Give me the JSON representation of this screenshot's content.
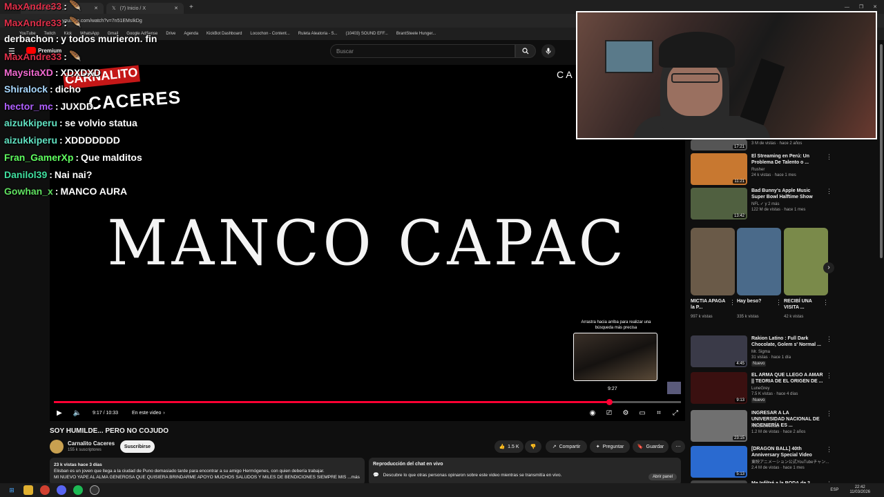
{
  "browser": {
    "tabs": [
      {
        "label": "MaxAndre33 - F..."
      },
      {
        "label": "(7) Inicio / X"
      }
    ],
    "url": "youtube.com/watch?v=7n51EMsIkDg",
    "bookmarks": [
      "YouTube",
      "Twitch",
      "Kick",
      "WhatsApp",
      "Gmail",
      "Google AdSense",
      "Drive",
      "Agenda",
      "KickBot Dashboard",
      "Locochon - Content...",
      "Ruleta Aleatoria - S...",
      "(10403) SOUND EFF...",
      "BrantSteele Hunger..."
    ]
  },
  "youtube": {
    "brand": "Premium",
    "search_placeholder": "Buscar"
  },
  "player": {
    "overlay_text": "MANCO CAPAC",
    "logo_top": "CARNALITO",
    "logo_bottom": "CACERES",
    "hint": "Arrastra hacia arriba para realizar una búsqueda más precisa",
    "preview_time": "9:27",
    "progress": 0.885,
    "time": "9:17 / 10:33",
    "chapter": "En este video",
    "corner_letters": "C A"
  },
  "video": {
    "title": "SOY HUMILDE... PERO NO COJUDO",
    "channel": "Carnalito Caceres",
    "subs": "155 k suscriptores",
    "subscribe": "Suscribirse",
    "likes": "1.5 K",
    "share": "Compartir",
    "ask": "Preguntar",
    "save": "Guardar",
    "desc_meta": "23 k vistas  hace 3 días",
    "desc_line1": "Elisban es un joven que llega a la ciudad de Puno demasiado tarde para encontrar a su amigo Hermógenes, con quien debería trabajar.",
    "desc_line2": "MI NUEVO YAPE AL ALMA GENEROSA QUE QUISIERA BRINDARME APOYO MUCHOS SALUDOS Y MILES DE BENDICIONES SIEMPRE MIS ...más",
    "chat_title": "Reproducción del chat en vivo",
    "chat_desc": "Descubre lo que otras personas opinaron sobre este video mientras se transmitía en vivo.",
    "chat_btn": "Abrir panel"
  },
  "sidebar": {
    "top_item": {
      "meta": "3 M de vistas · hace 2 años",
      "dur": "17:21"
    },
    "items": [
      {
        "title": "El Streaming en Perú: Un Problema De Talento o ...",
        "channel": "Rusher",
        "meta": "24 k vistas · hace 1 mes",
        "dur": "11:21",
        "color": "#c87830"
      },
      {
        "title": "Bad Bunny's Apple Music Super Bowl Halftime Show",
        "channel": "NFL ✓ y 2 más",
        "meta": "122 M de vistas · hace 1 mes",
        "dur": "13:42",
        "color": "#506040"
      },
      {
        "title": "Rakion Latino : Full Dark Chocolate, Golem s' Normal ...",
        "channel": "Mr. Sigma",
        "meta": "31 vistas · hace 1 día",
        "badge": "Nuevo",
        "dur": "4:45",
        "color": "#3a3a48"
      },
      {
        "title": "EL ARMA QUE LLEGO A AMAR || TEORIA DE EL ORIGEN DE ...",
        "channel": "LuneGrey",
        "meta": "7.5 K vistas · hace 4 días",
        "badge": "Nuevo",
        "dur": "9:13",
        "color": "#3a1010"
      },
      {
        "title": "INGRESAR A LA UNIVERSIDAD NACIONAL DE INGENIERÍA ES ...",
        "channel": "NN Entrevistas",
        "meta": "1.2 M de vistas · hace 2 años",
        "dur": "23:15",
        "color": "#707070"
      },
      {
        "title": "[DRAGON BALL] 40th Anniversary Special Video",
        "channel": "東映アニメーション公式YouTubeチャン...",
        "meta": "2.4 M de vistas · hace 1 mes",
        "dur": "5:13",
        "color": "#2a6ad0"
      },
      {
        "title": "Me Infiltré a la BODA de 2 ...",
        "channel": "",
        "meta": "",
        "dur": "",
        "color": "#444"
      }
    ],
    "shorts": [
      {
        "title": "MICTIA APAGA la P...",
        "views": "997 k vistas",
        "color": "#6a5a48"
      },
      {
        "title": "Hay beso?",
        "views": "335 k vistas",
        "color": "#4a6a8a"
      },
      {
        "title": "RECIBÍ UNA VISITA ...",
        "views": "42 k vistas",
        "color": "#7a8a4a"
      }
    ]
  },
  "chat": [
    {
      "user": "MaxAndre33",
      "msg": "",
      "color": "#e0304a"
    },
    {
      "user": "MaxAndre33",
      "msg": "",
      "color": "#e0304a"
    },
    {
      "user": "derbachon",
      "msg": "y todos murieron. fin",
      "color": "#ffffff"
    },
    {
      "user": "MaxAndre33",
      "msg": "",
      "color": "#e0304a"
    },
    {
      "user": "MaysitaXD",
      "msg": "XDXDXD",
      "color": "#f06ad0"
    },
    {
      "user": "Shiralock",
      "msg": "dicho",
      "color": "#a8d8ff"
    },
    {
      "user": "hector_mc",
      "msg": "JUXDD",
      "color": "#b060ff"
    },
    {
      "user": "aizukkiperu",
      "msg": "se volvio statua",
      "color": "#60e0c0"
    },
    {
      "user": "aizukkiperu",
      "msg": "XDDDDDDD",
      "color": "#60e0c0"
    },
    {
      "user": "Fran_GamerXp",
      "msg": "Que malditos",
      "color": "#60ff60"
    },
    {
      "user": "Danilol39",
      "msg": "Nai nai?",
      "color": "#40e0a0"
    },
    {
      "user": "Gowhan_x",
      "msg": "MANCO AURA",
      "color": "#60e060"
    }
  ],
  "taskbar": {
    "lang": "ESP",
    "time": "22:42",
    "date": "11/03/2026"
  }
}
